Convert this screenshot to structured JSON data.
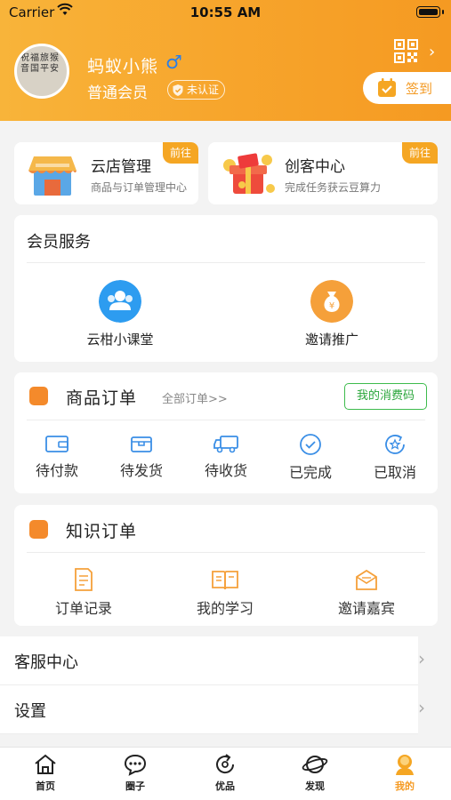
{
  "status_bar": {
    "carrier": "Carrier",
    "time": "10:55 AM"
  },
  "profile": {
    "username": "蚂蚁小熊",
    "gender_symbol": "♂",
    "member_level": "普通会员",
    "auth_status": "未认证",
    "avatar_text": [
      "祝",
      "福",
      "旅",
      "猴",
      "音",
      "国",
      "平",
      "安"
    ]
  },
  "checkin": {
    "label": "签到"
  },
  "entries": [
    {
      "title": "云店管理",
      "subtitle": "商品与订单管理中心",
      "badge": "前往"
    },
    {
      "title": "创客中心",
      "subtitle": "完成任务获云豆算力",
      "badge": "前往"
    }
  ],
  "member_service": {
    "title": "会员服务",
    "items": [
      {
        "label": "云柑小课堂",
        "icon": "people-icon",
        "color": "#2d9cf0"
      },
      {
        "label": "邀请推广",
        "icon": "money-bag-icon",
        "color": "#f5a03a"
      }
    ]
  },
  "goods_orders": {
    "title": "商品订单",
    "all_link": "全部订单>>",
    "consume_code": "我的消费码",
    "statuses": [
      {
        "label": "待付款",
        "icon": "wallet-icon"
      },
      {
        "label": "待发货",
        "icon": "box-icon"
      },
      {
        "label": "待收货",
        "icon": "truck-icon"
      },
      {
        "label": "已完成",
        "icon": "check-circle-icon"
      },
      {
        "label": "已取消",
        "icon": "star-refresh-icon"
      }
    ]
  },
  "knowledge_orders": {
    "title": "知识订单",
    "items": [
      {
        "label": "订单记录",
        "icon": "document-icon"
      },
      {
        "label": "我的学习",
        "icon": "book-icon"
      },
      {
        "label": "邀请嘉宾",
        "icon": "envelope-icon"
      }
    ]
  },
  "list_rows": [
    {
      "label": "客服中心"
    },
    {
      "label": "设置"
    }
  ],
  "tabbar": {
    "active": "我的",
    "accent": "#f59a22",
    "tabs": [
      {
        "label": "首页",
        "icon": "home-icon"
      },
      {
        "label": "圈子",
        "icon": "chat-icon"
      },
      {
        "label": "优品",
        "icon": "refresh-icon"
      },
      {
        "label": "发现",
        "icon": "planet-icon"
      },
      {
        "label": "我的",
        "icon": "user-icon"
      }
    ]
  },
  "colors": {
    "header": "#f7a52c",
    "accent": "#f59a22",
    "green": "#3dbb4c"
  }
}
